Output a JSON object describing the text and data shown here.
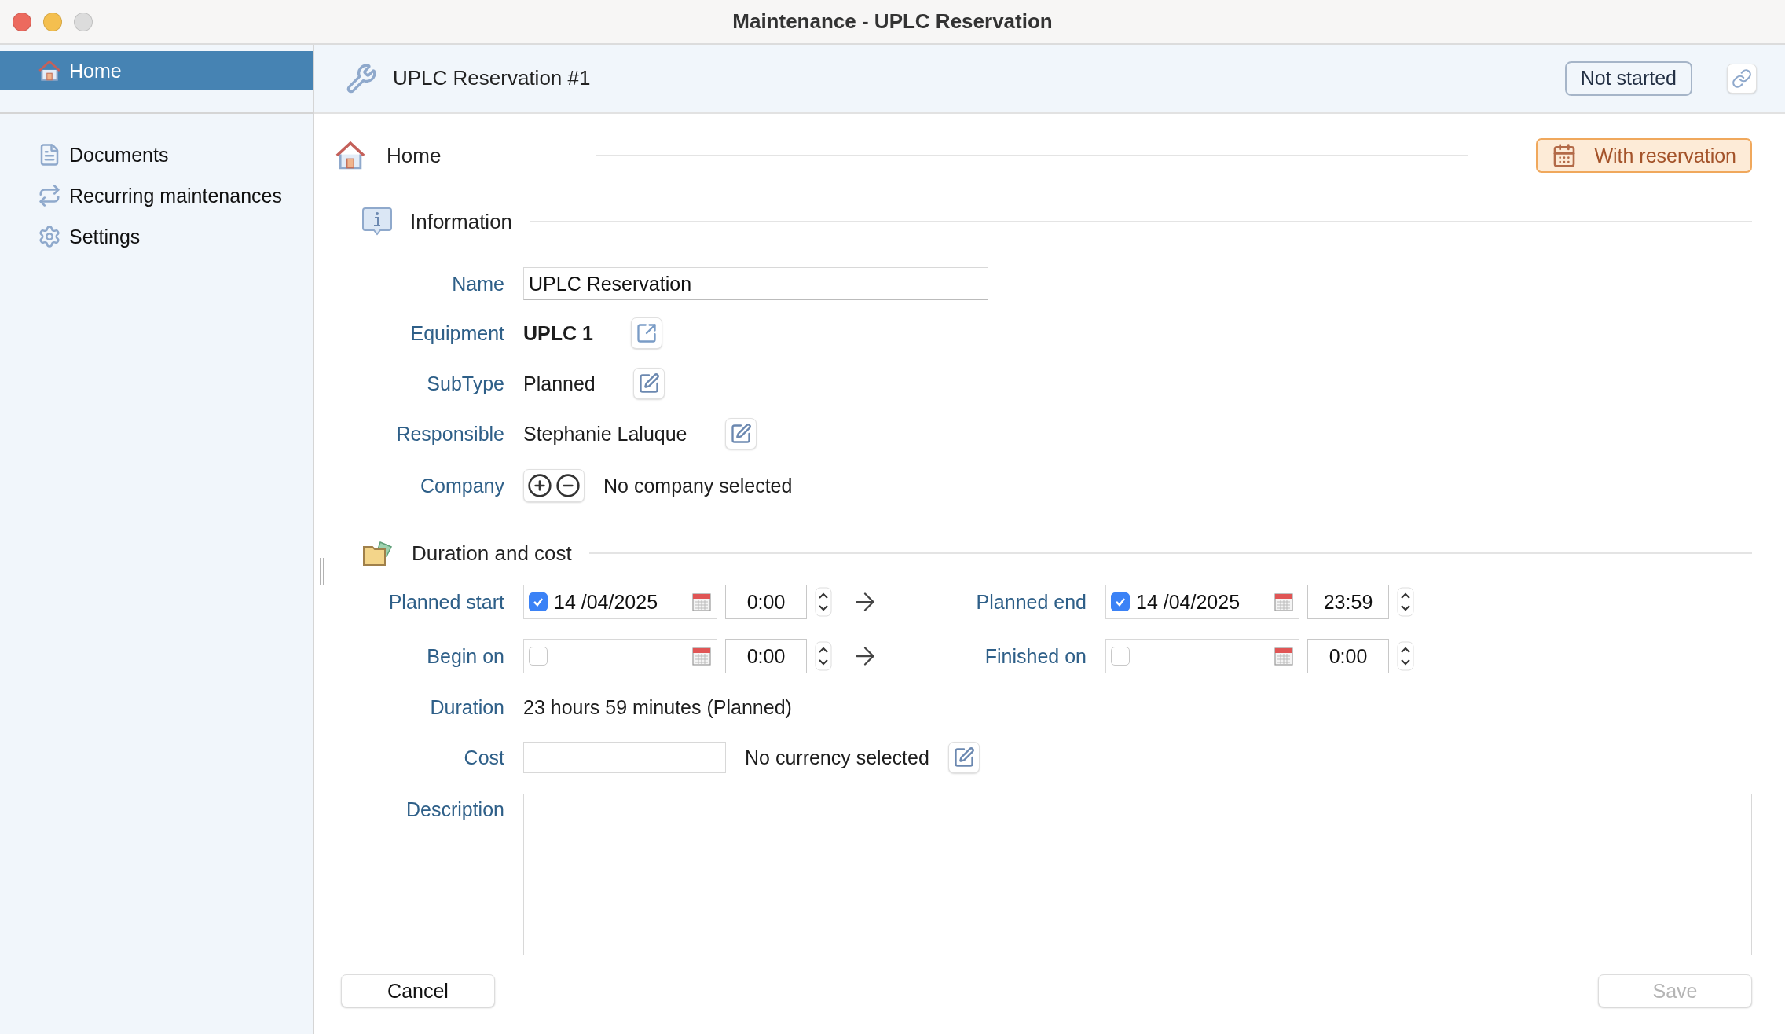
{
  "window": {
    "title": "Maintenance - UPLC Reservation"
  },
  "sidebar": {
    "items": [
      {
        "label": "Home",
        "kind": "home",
        "selected": true
      },
      {
        "label": "Documents",
        "kind": "document",
        "selected": false
      },
      {
        "label": "Recurring maintenances",
        "kind": "recurring",
        "selected": false
      },
      {
        "label": "Settings",
        "kind": "settings",
        "selected": false
      }
    ]
  },
  "header": {
    "title": "UPLC Reservation #1",
    "status": "Not started"
  },
  "page": {
    "title": "Home",
    "badge": "With reservation"
  },
  "information": {
    "title": "Information",
    "fields": [
      {
        "kind": "input",
        "label": "Name",
        "value": "UPLC Reservation"
      },
      {
        "kind": "link",
        "label": "Equipment",
        "value": "UPLC 1"
      },
      {
        "kind": "edit",
        "label": "SubType",
        "value": "Planned"
      },
      {
        "kind": "edit",
        "label": "Responsible",
        "value": "Stephanie Laluque"
      },
      {
        "kind": "company",
        "label": "Company",
        "value": "No company selected"
      }
    ]
  },
  "duration": {
    "title": "Duration and cost",
    "date_rows": [
      {
        "start": {
          "label": "Planned start",
          "checked": true,
          "date": "14 /04/2025",
          "time": "0:00"
        },
        "end": {
          "label": "Planned end",
          "checked": true,
          "date": "14 /04/2025",
          "time": "23:59"
        }
      },
      {
        "start": {
          "label": "Begin on",
          "checked": false,
          "time": "0:00"
        },
        "end": {
          "label": "Finished on",
          "checked": false,
          "time": "0:00"
        }
      }
    ],
    "duration": {
      "label": "Duration",
      "value": "23 hours 59 minutes (Planned)"
    },
    "cost": {
      "label": "Cost",
      "currency": "No currency selected"
    },
    "description": {
      "label": "Description"
    }
  },
  "buttons": {
    "cancel": {
      "label": "Cancel",
      "disabled": false
    },
    "save": {
      "label": "Save",
      "disabled": true
    }
  }
}
